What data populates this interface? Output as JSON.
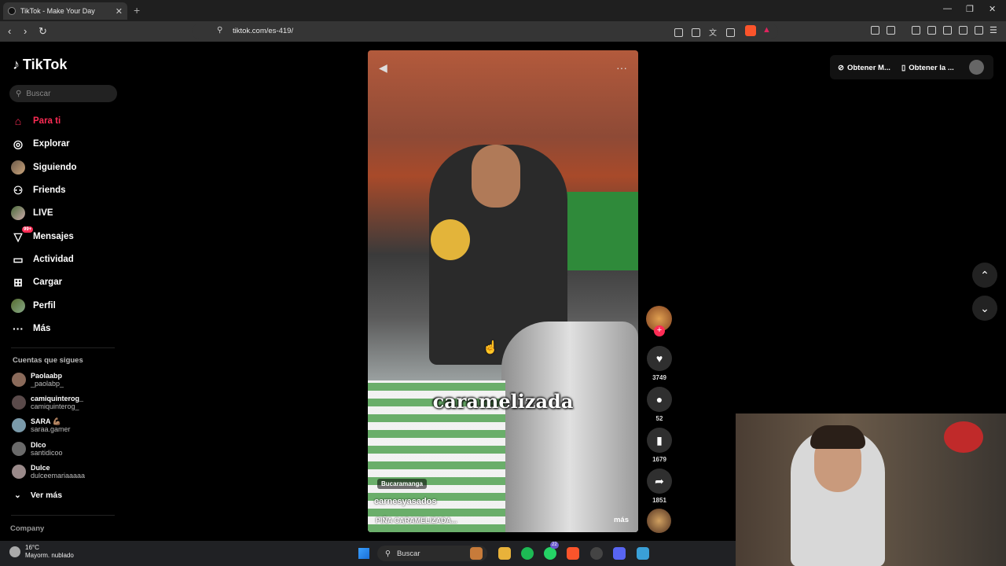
{
  "browser": {
    "tab_title": "TikTok - Make Your Day",
    "url": "tiktok.com/es-419/"
  },
  "sidebar": {
    "logo_text": "TikTok",
    "search_placeholder": "Buscar",
    "nav": [
      {
        "label": "Para ti",
        "icon": "home-icon",
        "active": true
      },
      {
        "label": "Explorar",
        "icon": "compass-icon"
      },
      {
        "label": "Siguiendo",
        "icon": "avatar"
      },
      {
        "label": "Friends",
        "icon": "friends-icon"
      },
      {
        "label": "LIVE",
        "icon": "avatar"
      },
      {
        "label": "Mensajes",
        "icon": "inbox-icon",
        "badge": "99+"
      },
      {
        "label": "Actividad",
        "icon": "message-icon"
      },
      {
        "label": "Cargar",
        "icon": "plus-icon"
      },
      {
        "label": "Perfil",
        "icon": "avatar"
      },
      {
        "label": "Más",
        "icon": "more-icon"
      }
    ],
    "following_title": "Cuentas que sigues",
    "following": [
      {
        "name": "Paolaabp",
        "username": "_paolabp_"
      },
      {
        "name": "camiquinterog_",
        "username": "camiquinterog_"
      },
      {
        "name": "SARA 💪🏽",
        "username": "saraa.gamer"
      },
      {
        "name": "DIco",
        "username": "santidicoo"
      },
      {
        "name": "Dulce",
        "username": "dulceemariaaaaa"
      }
    ],
    "more_following": "Ver más",
    "company": "Company"
  },
  "video": {
    "caption": "caramelizada",
    "location": "Bucaramanga",
    "author": "carnesyasados",
    "description": "PIÑA CARAMELIZADA...",
    "more": "más"
  },
  "actions": {
    "likes": "3749",
    "comments": "52",
    "saves": "1679",
    "shares": "1851"
  },
  "top_right": {
    "get_coins": "Obtener M...",
    "get_app": "Obtener la ..."
  },
  "taskbar": {
    "temperature": "16°C",
    "weather": "Mayorm. nublado",
    "search": "Buscar",
    "whatsapp_badge": "22"
  }
}
